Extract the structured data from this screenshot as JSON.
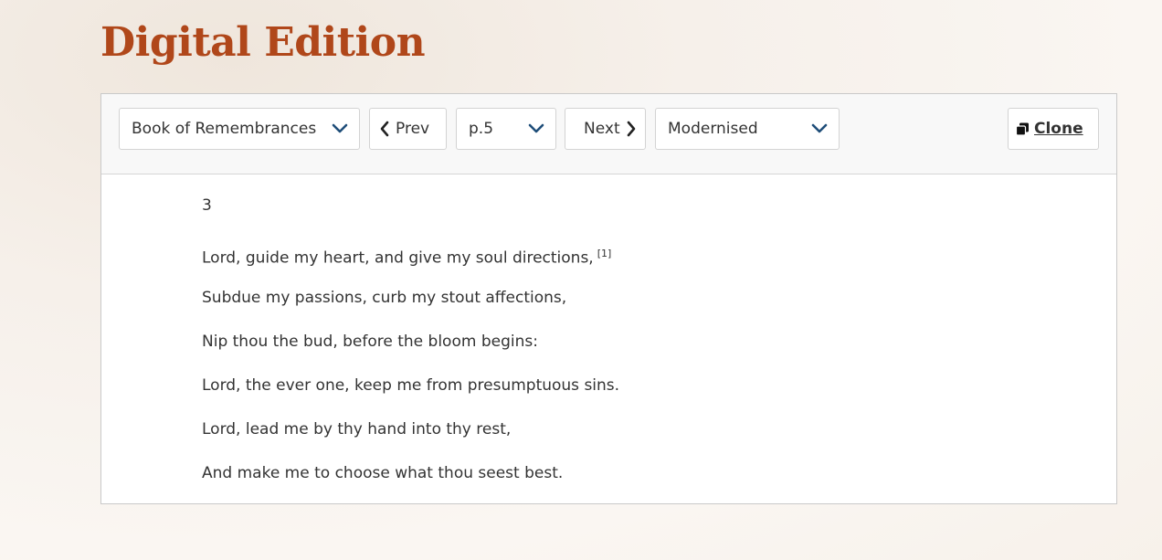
{
  "page": {
    "title": "Digital Edition"
  },
  "toolbar": {
    "book_select": {
      "value": "Book of Remembrances",
      "icon": "chevron-down-icon"
    },
    "prev_button": {
      "label": "Prev",
      "icon": "chevron-left-icon"
    },
    "page_select": {
      "value": "p.5",
      "icon": "chevron-down-icon"
    },
    "next_button": {
      "label": "Next",
      "icon": "chevron-right-icon"
    },
    "mode_select": {
      "value": "Modernised",
      "icon": "chevron-down-icon"
    },
    "clone_button": {
      "label": "Clone",
      "icon": "clone-icon"
    }
  },
  "content": {
    "page_number": "3",
    "lines": [
      {
        "text": "Lord, guide my heart, and give my soul directions,",
        "footnote": "[1]"
      },
      {
        "text": "Subdue my passions, curb my stout affections,"
      },
      {
        "text": "Nip thou the bud, before the bloom begins:"
      },
      {
        "text": "Lord, the ever one, keep me from presumptuous sins."
      },
      {
        "text": "Lord, lead me by thy hand into thy rest,"
      },
      {
        "text": "And make me to choose what thou seest best."
      }
    ]
  },
  "colors": {
    "title": "#b0471a",
    "chevron": "#1f4e79",
    "text": "#333333",
    "panel_border": "#c9c9c9",
    "toolbar_bg": "#f8f8f8"
  }
}
